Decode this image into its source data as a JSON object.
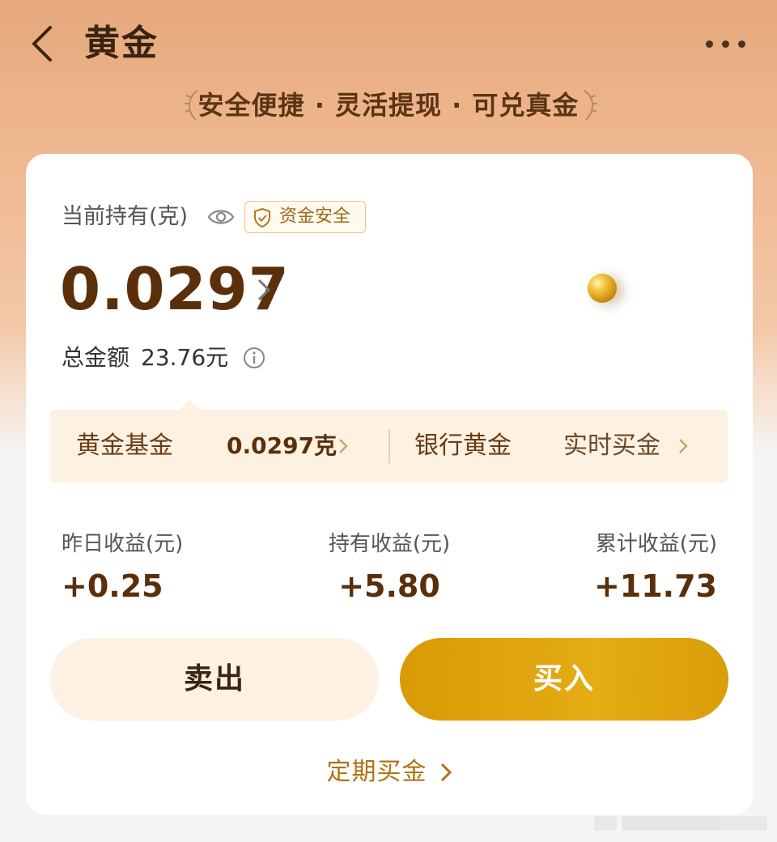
{
  "header": {
    "title": "黄金",
    "slogan": "安全便捷 · 灵活提现 · 可兑真金"
  },
  "holding": {
    "label": "当前持有(克)",
    "badge": "资金安全",
    "amount": "0.0297",
    "total_label": "总金额",
    "total_value": "23.76元"
  },
  "tabs": {
    "left_name": "黄金基金",
    "left_value": "0.0297克",
    "right_name": "银行黄金",
    "right_value": "实时买金"
  },
  "stats": [
    {
      "label": "昨日收益(元)",
      "value": "+0.25"
    },
    {
      "label": "持有收益(元)",
      "value": "+5.80"
    },
    {
      "label": "累计收益(元)",
      "value": "+11.73"
    }
  ],
  "actions": {
    "sell": "卖出",
    "buy": "买入",
    "periodic": "定期买金"
  },
  "colors": {
    "accent": "#e0a40e",
    "brown": "#5a2f0a",
    "link": "#b07214"
  },
  "icons": [
    "back-arrow-icon",
    "more-icon",
    "laurel-icon",
    "eye-icon",
    "shield-check-icon",
    "chevron-right-icon",
    "info-icon",
    "gold-ball-icon"
  ]
}
